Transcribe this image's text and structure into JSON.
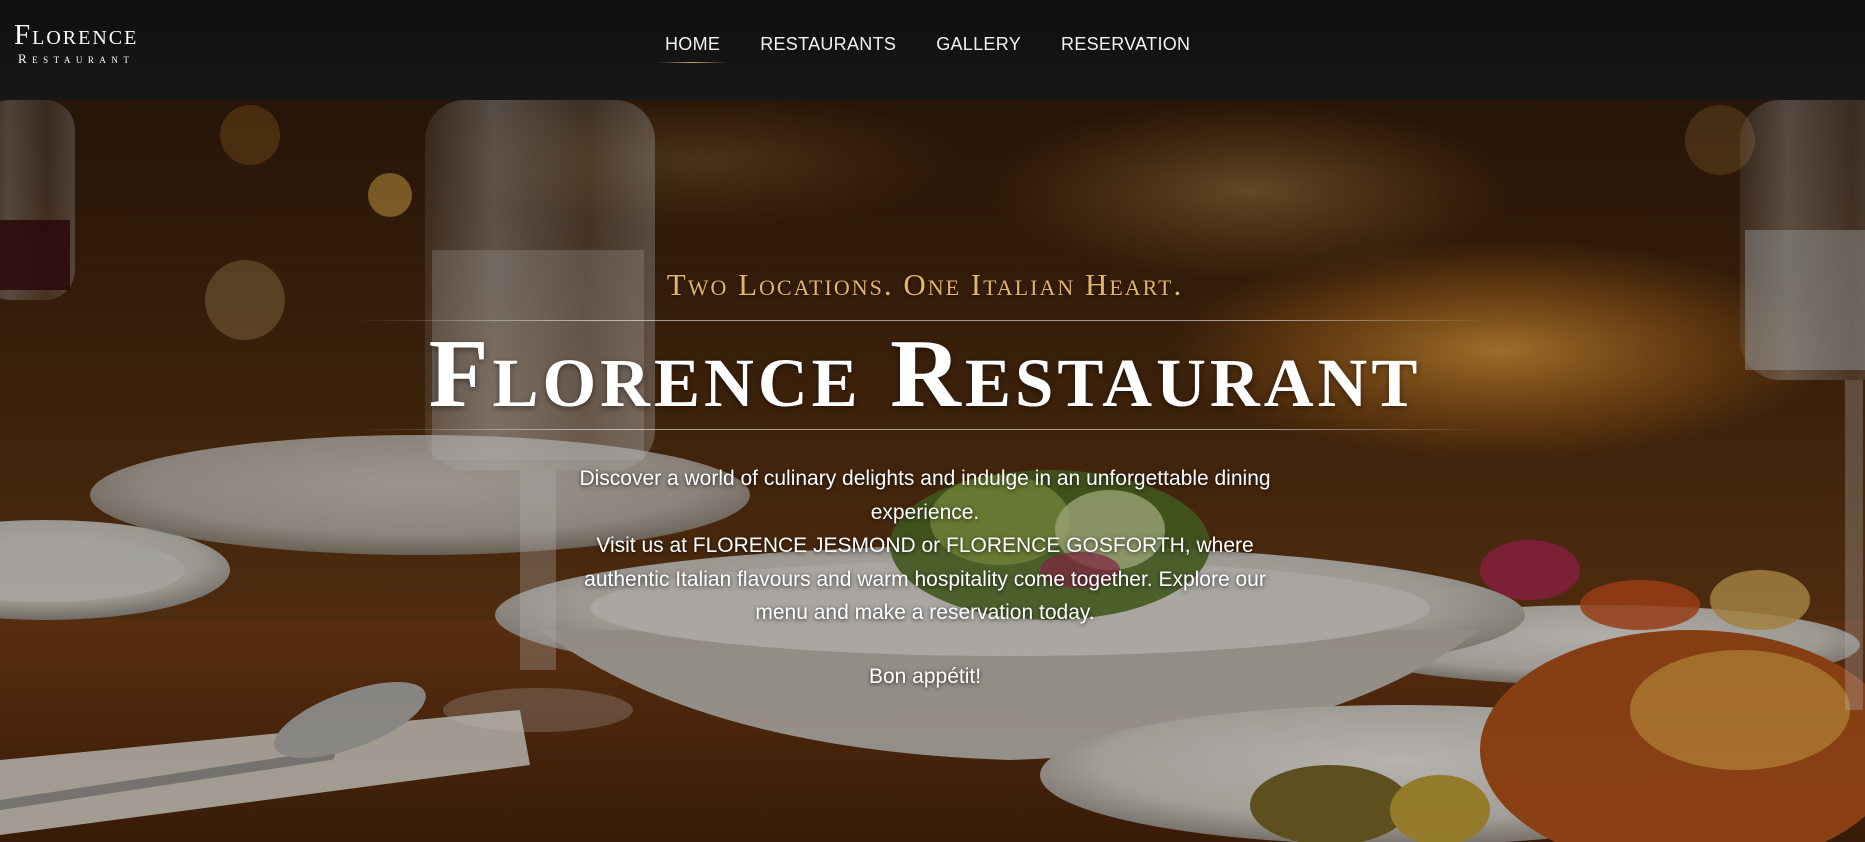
{
  "brand": {
    "name": "Florence",
    "subtitle": "Restaurant"
  },
  "nav": {
    "items": [
      {
        "label": "HOME",
        "active": true
      },
      {
        "label": "RESTAURANTS",
        "active": false
      },
      {
        "label": "GALLERY",
        "active": false
      },
      {
        "label": "RESERVATION",
        "active": false
      }
    ]
  },
  "hero": {
    "tagline": "Two Locations. One Italian Heart.",
    "title": "Florence Restaurant",
    "description_line1": "Discover a world of culinary delights and indulge in an unforgettable dining experience.",
    "description_line2": "Visit us at FLORENCE JESMOND or FLORENCE GOSFORTH, where authentic Italian flavours and warm hospitality come together. Explore our menu and make a reservation today.",
    "closing": "Bon appétit!"
  },
  "colors": {
    "header_bg": "#121212",
    "accent_gold": "#e2b56a",
    "text_white": "#ffffff"
  }
}
